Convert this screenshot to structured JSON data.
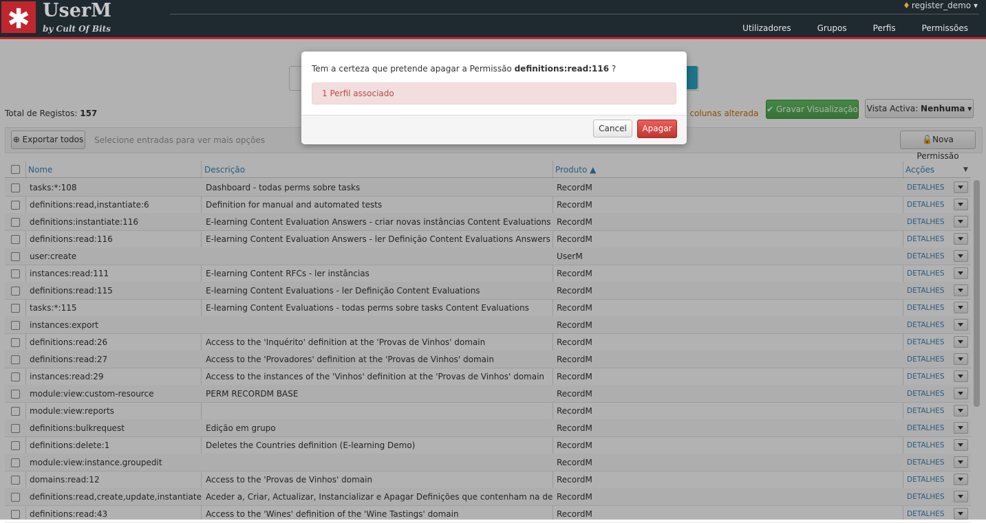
{
  "app": {
    "title": "UserM",
    "subtitle": "by Cult Of Bits",
    "logo_glyph": "✱"
  },
  "user_menu": {
    "name": "register_demo"
  },
  "nav": {
    "items": [
      "Utilizadores",
      "Grupos",
      "Perfis",
      "Permissões"
    ]
  },
  "toolbar": {
    "total_label": "Total de Registos:",
    "total_value": "157",
    "cols_altered": "as colunas alterada",
    "save_view": "Gravar Visualização",
    "view_label": "Vista Activa:",
    "view_value": "Nenhuma",
    "export_all": "Exportar todos",
    "select_hint": "Selecione entradas para ver mais opções",
    "new_permission": "Nova Permissão"
  },
  "table": {
    "headers": {
      "nome": "Nome",
      "descricao": "Descrição",
      "produto": "Produto ▲",
      "accoes": "Acções"
    },
    "details_label": "DETALHES",
    "rows": [
      {
        "nome": "tasks:*:108",
        "descricao": "Dashboard - todas perms sobre tasks",
        "produto": "RecordM"
      },
      {
        "nome": "definitions:read,instantiate:6",
        "descricao": "Definition for manual and automated tests",
        "produto": "RecordM"
      },
      {
        "nome": "definitions:instantiate:116",
        "descricao": "E-learning Content Evaluation Answers - criar novas instâncias Content Evaluations Answers",
        "produto": "RecordM"
      },
      {
        "nome": "definitions:read:116",
        "descricao": "E-learning Content Evaluation Answers - ler Definição Content Evaluations Answers",
        "produto": "RecordM"
      },
      {
        "nome": "user:create",
        "descricao": "",
        "produto": "UserM"
      },
      {
        "nome": "instances:read:111",
        "descricao": "E-learning Content RFCs - ler instâncias",
        "produto": "RecordM"
      },
      {
        "nome": "definitions:read:115",
        "descricao": "E-learning Content Evaluations - ler Definição Content Evaluations",
        "produto": "RecordM"
      },
      {
        "nome": "tasks:*:115",
        "descricao": "E-learning Content Evaluations - todas perms sobre tasks Content Evaluations",
        "produto": "RecordM"
      },
      {
        "nome": "instances:export",
        "descricao": "",
        "produto": "RecordM"
      },
      {
        "nome": "definitions:read:26",
        "descricao": "Access to the 'Inquérito' definition at the 'Provas de Vinhos' domain",
        "produto": "RecordM"
      },
      {
        "nome": "definitions:read:27",
        "descricao": "Access to the 'Provadores' definition at the 'Provas de Vinhos' domain",
        "produto": "RecordM"
      },
      {
        "nome": "instances:read:29",
        "descricao": "Access to the instances of the 'Vinhos' definition at the 'Provas de Vinhos' domain",
        "produto": "RecordM"
      },
      {
        "nome": "module:view:custom-resource",
        "descricao": "PERM RECORDM BASE",
        "produto": "RecordM"
      },
      {
        "nome": "module:view:reports",
        "descricao": "",
        "produto": "RecordM"
      },
      {
        "nome": "definitions:bulkrequest",
        "descricao": "Edição em grupo",
        "produto": "RecordM"
      },
      {
        "nome": "definitions:delete:1",
        "descricao": "Deletes the Countries definition (E-learning Demo)",
        "produto": "RecordM"
      },
      {
        "nome": "module:view:instance.groupedit",
        "descricao": "",
        "produto": "RecordM"
      },
      {
        "nome": "domains:read:12",
        "descricao": "Access to the 'Provas de Vinhos' domain",
        "produto": "RecordM"
      },
      {
        "nome": "definitions:read,create,update,instantiate,...",
        "descricao": "Aceder a, Criar, Actualizar, Instancializar e Apagar Definições que contenham na descriçã...",
        "produto": "RecordM"
      },
      {
        "nome": "definitions:read:43",
        "descricao": "Access to the 'Wines' definition of the 'Wine Tastings' domain",
        "produto": "RecordM"
      }
    ]
  },
  "modal": {
    "question_prefix": "Tem a certeza que pretende apagar a Permissão",
    "question_target": "definitions:read:116",
    "question_suffix": "?",
    "alert": "1 Perfil associado",
    "cancel": "Cancel",
    "confirm": "Apagar"
  },
  "colors": {
    "brand": "#c1262f",
    "header_bg": "#1f2a30",
    "link": "#3a83b8",
    "danger": "#bd362f",
    "success": "#51a351"
  }
}
